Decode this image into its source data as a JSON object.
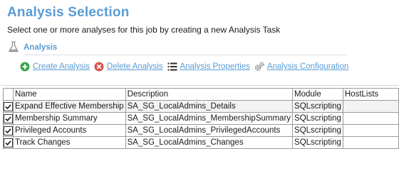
{
  "header": {
    "title": "Analysis Selection",
    "subtitle": "Select one or more analyses for this job by creating a new Analysis Task"
  },
  "section": {
    "label": "Analysis",
    "icon": "flask-icon"
  },
  "toolbar": {
    "items": [
      {
        "label": "Create Analysis",
        "icon": "plus-circle-icon",
        "color": "#3aa648"
      },
      {
        "label": "Delete Analysis",
        "icon": "delete-circle-icon",
        "color": "#d9534f"
      },
      {
        "label": "Analysis Properties",
        "icon": "list-icon"
      },
      {
        "label": "Analysis Configuration",
        "icon": "gears-icon"
      }
    ]
  },
  "grid": {
    "columns": [
      "",
      "Name",
      "Description",
      "Module",
      "HostLists"
    ],
    "rows": [
      {
        "checked": true,
        "name": "Expand Effective Membership",
        "description": "SA_SG_LocalAdmins_Details",
        "module": "SQLscripting",
        "hostlists": ""
      },
      {
        "checked": true,
        "name": "Membership Summary",
        "description": "SA_SG_LocalAdmins_MembershipSummary",
        "module": "SQLscripting",
        "hostlists": ""
      },
      {
        "checked": true,
        "name": "Privileged Accounts",
        "description": "SA_SG_LocalAdmins_PrivilegedAccounts",
        "module": "SQLscripting",
        "hostlists": ""
      },
      {
        "checked": true,
        "name": "Track Changes",
        "description": "SA_SG_LocalAdmins_Changes",
        "module": "SQLscripting",
        "hostlists": ""
      }
    ]
  },
  "colors": {
    "accent": "#5b9bd5",
    "grid_border": "#9a9a9a"
  }
}
